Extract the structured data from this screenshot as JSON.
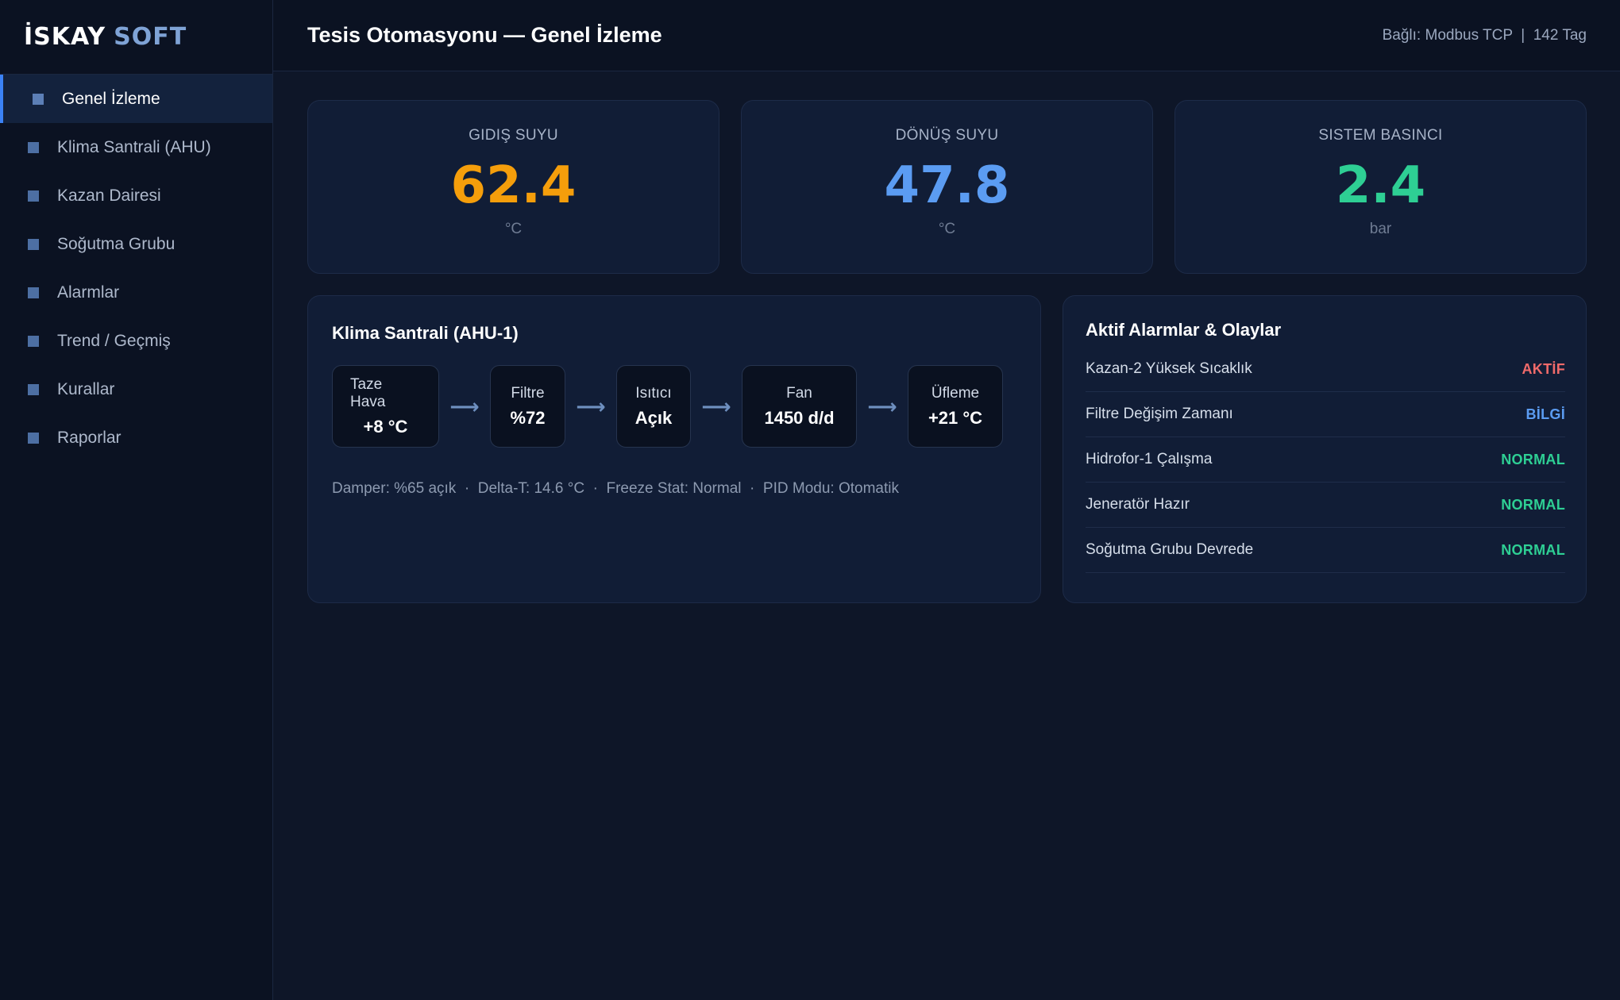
{
  "brand": {
    "part1": "İSKAY",
    "part2": "SOFT"
  },
  "sidebar": {
    "items": [
      {
        "label": "Genel İzleme",
        "active": true
      },
      {
        "label": "Klima Santrali (AHU)"
      },
      {
        "label": "Kazan Dairesi"
      },
      {
        "label": "Soğutma Grubu"
      },
      {
        "label": "Alarmlar"
      },
      {
        "label": "Trend / Geçmiş"
      },
      {
        "label": "Kurallar"
      },
      {
        "label": "Raporlar"
      }
    ]
  },
  "header": {
    "title": "Tesis Otomasyonu — Genel İzleme",
    "connection": "Bağlı: Modbus TCP  |  142 Tag"
  },
  "kpis": [
    {
      "label": "GIDIŞ SUYU",
      "value": "62.4",
      "unit": "°C",
      "color": "#f59e0b"
    },
    {
      "label": "DÖNÜŞ SUYU",
      "value": "47.8",
      "unit": "°C",
      "color": "#5b9cf2"
    },
    {
      "label": "SISTEM BASINCI",
      "value": "2.4",
      "unit": "bar",
      "color": "#2ecf94"
    }
  ],
  "ahu": {
    "title": "Klima Santrali (AHU-1)",
    "steps": [
      {
        "label": "Taze Hava",
        "value": "+8 °C"
      },
      {
        "label": "Filtre",
        "value": "%72"
      },
      {
        "label": "Isıtıcı",
        "value": "Açık"
      },
      {
        "label": "Fan",
        "value": "1450 d/d"
      },
      {
        "label": "Üfleme",
        "value": "+21 °C"
      }
    ],
    "arrow": "⟶",
    "info": "Damper: %65 açık  ·  Delta-T: 14.6 °C  ·  Freeze Stat: Normal  ·  PID Modu: Otomatik"
  },
  "alarms": {
    "title": "Aktif Alarmlar & Olaylar",
    "items": [
      {
        "name": "Kazan-2 Yüksek Sıcaklık",
        "status": "AKTİF",
        "color": "#f06a6a"
      },
      {
        "name": "Filtre Değişim Zamanı",
        "status": "BİLGİ",
        "color": "#5b9cf2"
      },
      {
        "name": "Hidrofor-1 Çalışma",
        "status": "NORMAL",
        "color": "#2ecf94"
      },
      {
        "name": "Jeneratör Hazır",
        "status": "NORMAL",
        "color": "#2ecf94"
      },
      {
        "name": "Soğutma Grubu Devrede",
        "status": "NORMAL",
        "color": "#2ecf94"
      }
    ]
  }
}
